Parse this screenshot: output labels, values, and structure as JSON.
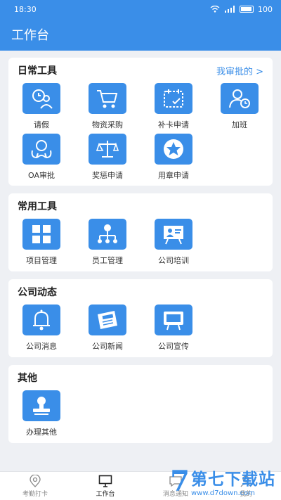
{
  "status_bar": {
    "time": "18:30",
    "battery": "100"
  },
  "app_bar": {
    "title": "工作台"
  },
  "sections": [
    {
      "title": "日常工具",
      "link": "我审批的 >",
      "tools": [
        {
          "label": "请假",
          "icon": "leave-icon"
        },
        {
          "label": "物资采购",
          "icon": "cart-icon"
        },
        {
          "label": "补卡申请",
          "icon": "calendar-icon"
        },
        {
          "label": "加班",
          "icon": "overtime-icon"
        },
        {
          "label": "OA审批",
          "icon": "approval-icon"
        },
        {
          "label": "奖惩申请",
          "icon": "scale-icon"
        },
        {
          "label": "用章申请",
          "icon": "star-seal-icon"
        }
      ]
    },
    {
      "title": "常用工具",
      "tools": [
        {
          "label": "项目管理",
          "icon": "grid-icon"
        },
        {
          "label": "员工管理",
          "icon": "org-chart-icon"
        },
        {
          "label": "公司培训",
          "icon": "training-icon"
        }
      ]
    },
    {
      "title": "公司动态",
      "tools": [
        {
          "label": "公司消息",
          "icon": "bell-icon"
        },
        {
          "label": "公司新闻",
          "icon": "newspaper-icon"
        },
        {
          "label": "公司宣传",
          "icon": "billboard-icon"
        }
      ]
    },
    {
      "title": "其他",
      "tools": [
        {
          "label": "办理其他",
          "icon": "stamp-icon"
        }
      ]
    }
  ],
  "tab_bar": {
    "tabs": [
      {
        "label": "考勤打卡",
        "icon": "location-icon"
      },
      {
        "label": "工作台",
        "icon": "monitor-icon"
      },
      {
        "label": "消息通知",
        "icon": "chat-icon"
      },
      {
        "label": "我的",
        "icon": "user-icon"
      }
    ]
  },
  "watermark": {
    "mark": "7",
    "title": "第七下载站",
    "url": "www.d7down.com"
  },
  "colors": {
    "primary": "#3a8ee8",
    "background": "#eef0f4"
  }
}
